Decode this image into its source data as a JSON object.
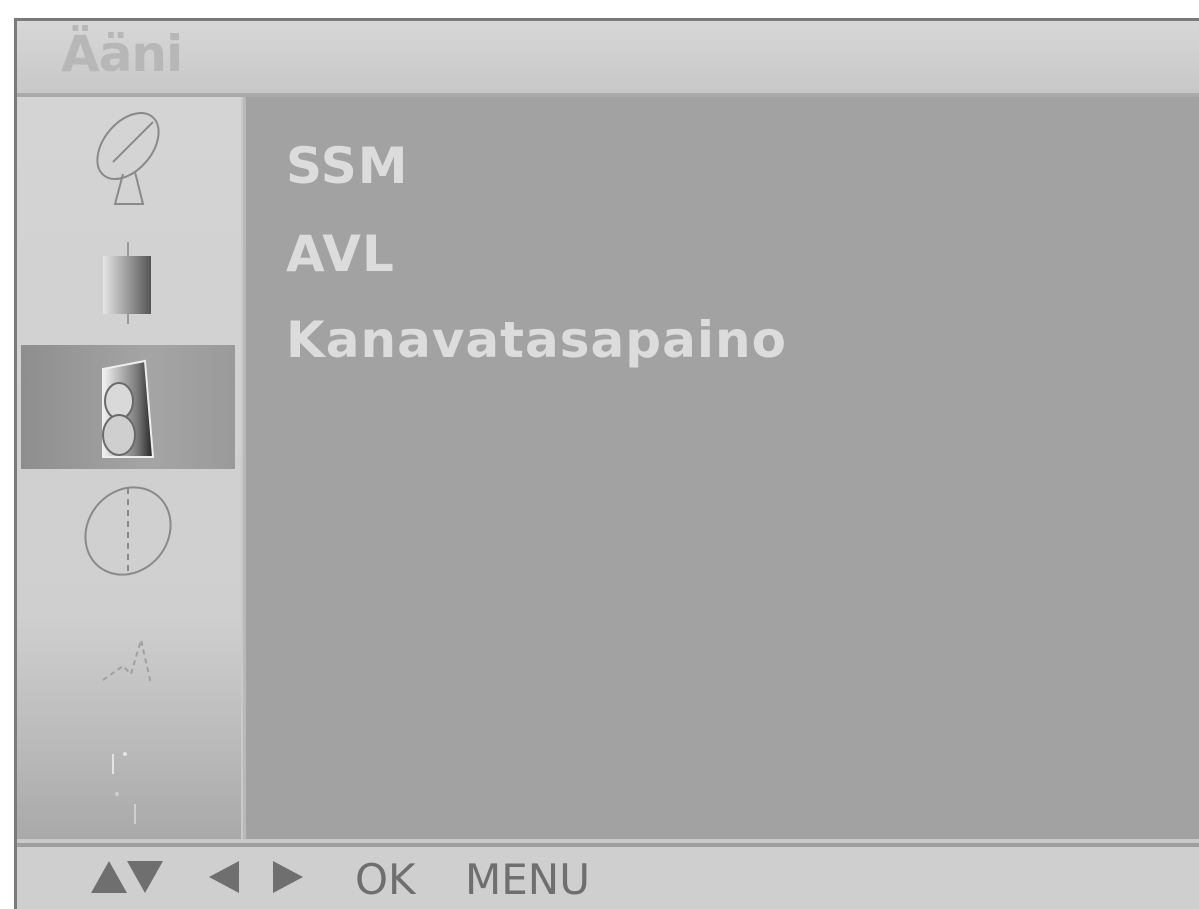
{
  "window": {
    "title": "Ääni"
  },
  "sidebar": {
    "items": [
      {
        "icon": "satellite-dish-icon",
        "selected": false
      },
      {
        "icon": "picture-icon",
        "selected": false
      },
      {
        "icon": "sound-icon",
        "selected": true
      },
      {
        "icon": "clock-icon",
        "selected": false
      },
      {
        "icon": "special-icon",
        "selected": false
      },
      {
        "icon": "screen-icon",
        "selected": false
      }
    ]
  },
  "menu": {
    "items": [
      {
        "label": "SSM"
      },
      {
        "label": "AVL"
      },
      {
        "label": "Kanavatasapaino"
      }
    ]
  },
  "footer": {
    "ok_label": "OK",
    "menu_label": "MENU"
  },
  "colors": {
    "background": "#c9c9c9",
    "content_panel": "#a2a2a2",
    "menu_text": "#dcdcdc",
    "selected_item": "#9a9a9a"
  }
}
